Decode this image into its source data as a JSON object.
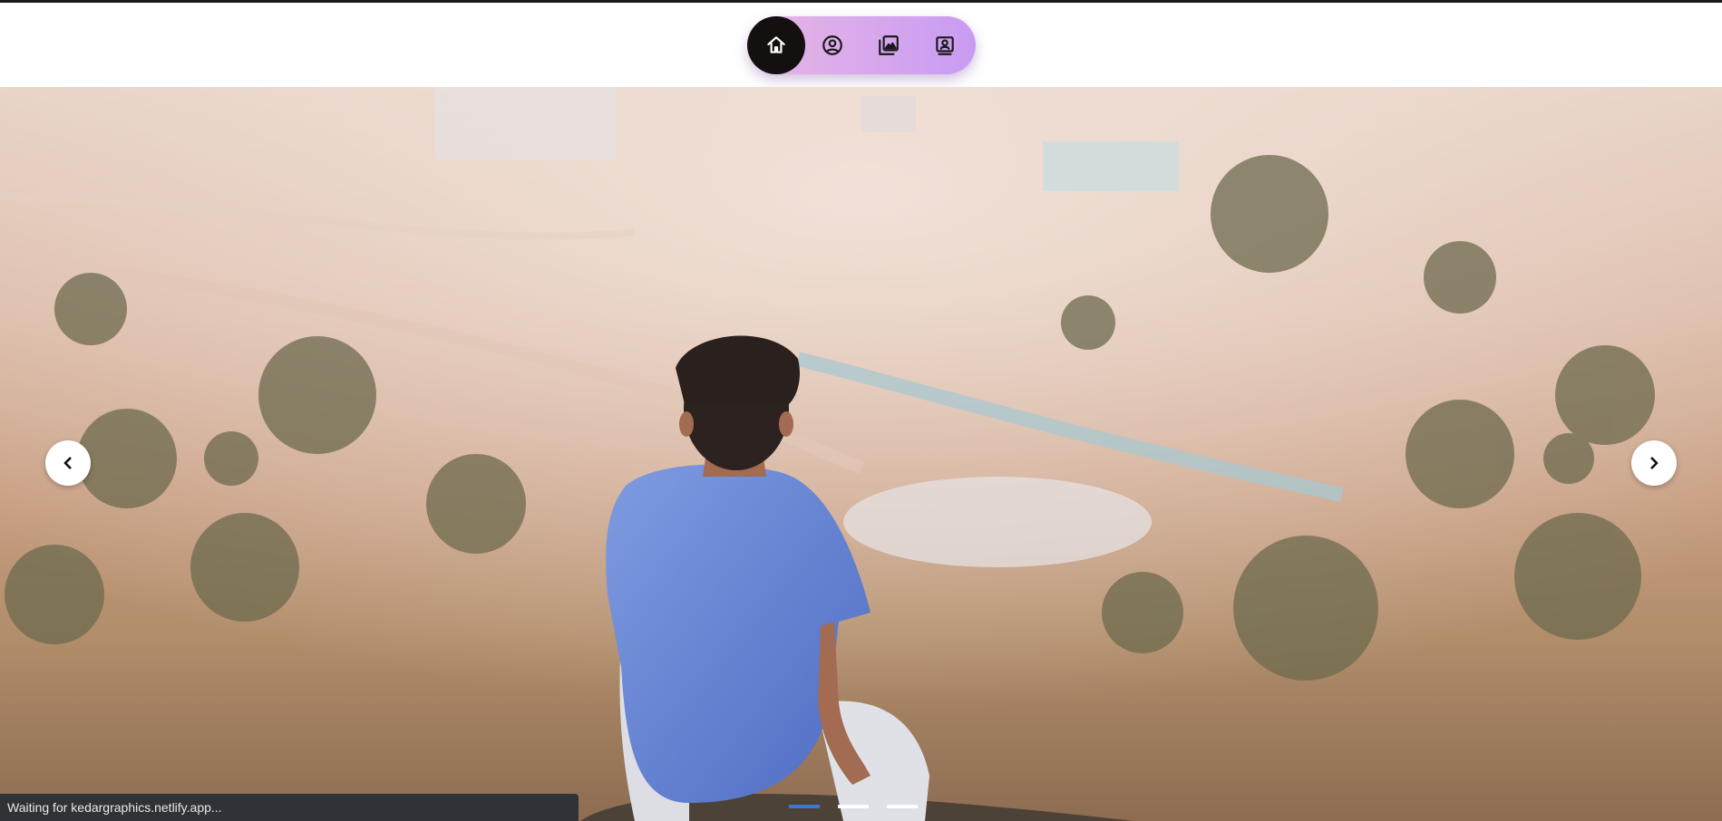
{
  "nav": {
    "items": [
      {
        "icon": "home-icon",
        "active": true
      },
      {
        "icon": "user-circle-icon",
        "active": false
      },
      {
        "icon": "gallery-icon",
        "active": false
      },
      {
        "icon": "contact-card-icon",
        "active": false
      }
    ]
  },
  "carousel": {
    "slide_count": 3,
    "active_slide": 1
  },
  "status_bar": {
    "text": "Waiting for kedargraphics.netlify.app..."
  }
}
